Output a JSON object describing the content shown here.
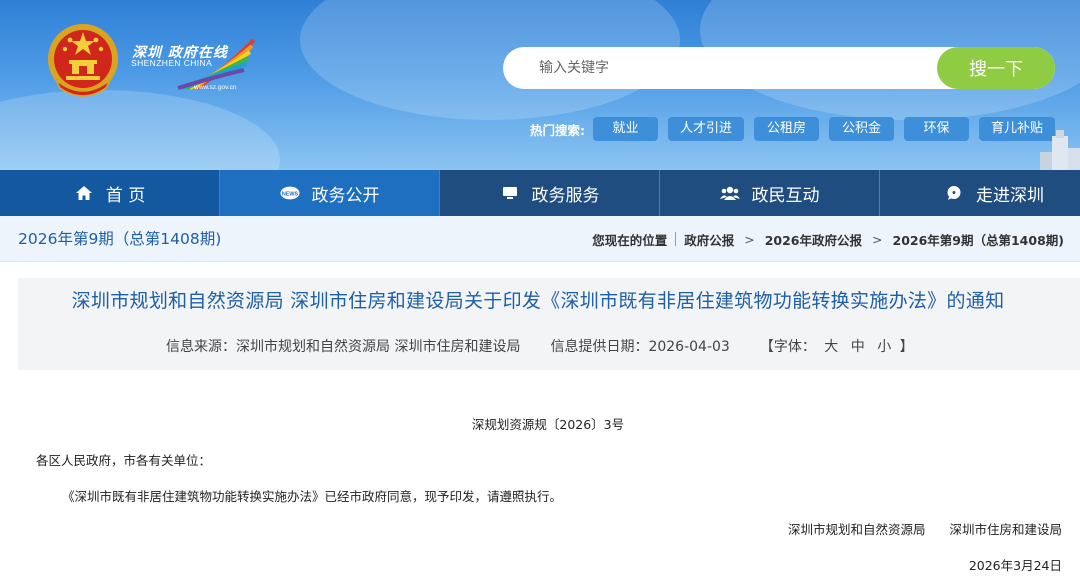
{
  "header": {
    "logo_cn": "深圳 政府在线",
    "logo_en": "SHENZHEN CHINA",
    "logo_url": "www.sz.gov.cn",
    "search": {
      "placeholder": "输入关键字",
      "button_label": "搜一下"
    },
    "hot": {
      "label": "热门搜索:",
      "tags": [
        "就业",
        "人才引进",
        "公租房",
        "公积金",
        "环保",
        "育儿补贴"
      ]
    }
  },
  "nav": {
    "items": [
      {
        "label": "首 页",
        "icon": "home-icon"
      },
      {
        "label": "政务公开",
        "icon": "news-icon"
      },
      {
        "label": "政务服务",
        "icon": "monitor-icon"
      },
      {
        "label": "政民互动",
        "icon": "users-icon"
      },
      {
        "label": "走进深圳",
        "icon": "chat-icon"
      }
    ]
  },
  "bar": {
    "issue": "2026年第9期（总第1408期)",
    "location_label": "您现在的位置",
    "crumbs": [
      "政府公报",
      "2026年政府公报",
      "2026年第9期（总第1408期)"
    ],
    "sep": ">"
  },
  "article": {
    "title": "深圳市规划和自然资源局 深圳市住房和建设局关于印发《深圳市既有非居住建筑物功能转换实施办法》的通知",
    "source": "信息来源：深圳市规划和自然资源局 深圳市住房和建设局",
    "date_provided": "信息提供日期：2026-04-03",
    "font_label_open": "【字体：",
    "font_large": "大",
    "font_medium": "中",
    "font_small": "小",
    "font_label_close": "】"
  },
  "body": {
    "doc_no": "深规划资源规〔2026〕3号",
    "salutation": "各区人民政府，市各有关单位：",
    "paragraph": "《深圳市既有非居住建筑物功能转换实施办法》已经市政府同意，现予印发，请遵照执行。",
    "signer_1": "深圳市规划和自然资源局",
    "signer_2": "深圳市住房和建设局",
    "date": "2026年3月24日"
  },
  "colors": {
    "header_sky": "#4e9ce6",
    "nav_blue": "#14589f",
    "title_blue": "#1e5fa8",
    "search_green": "#8fcc43",
    "tag_blue": "#3c8fd8"
  }
}
